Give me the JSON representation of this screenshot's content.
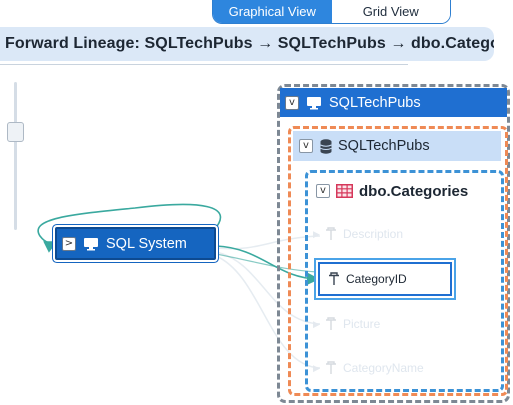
{
  "view_toggle": {
    "graphical_label": "Graphical View",
    "grid_label": "Grid View",
    "active": "graphical"
  },
  "title": "Forward Lineage: SQLTechPubs → SQLTechPubs → dbo.Categor…",
  "source_node": {
    "label": "SQL System",
    "expander": ">",
    "icon": "monitor-icon"
  },
  "server": {
    "label": "SQLTechPubs",
    "expander": "v",
    "icon": "monitor-icon"
  },
  "database": {
    "label": "SQLTechPubs",
    "expander": "v",
    "icon": "database-icon"
  },
  "table": {
    "label": "dbo.Categories",
    "expander": "v",
    "icon": "table-grid-icon",
    "columns": [
      {
        "name": "Description",
        "state": "faded"
      },
      {
        "name": "CategoryID",
        "state": "highlighted"
      },
      {
        "name": "Picture",
        "state": "faded"
      },
      {
        "name": "CategoryName",
        "state": "faded"
      }
    ]
  },
  "colors": {
    "primary": "#1f6fd1",
    "link": "#3aa99f",
    "server_border": "#7d8894",
    "db_border": "#ef8a55",
    "table_border": "#3c92d6"
  }
}
